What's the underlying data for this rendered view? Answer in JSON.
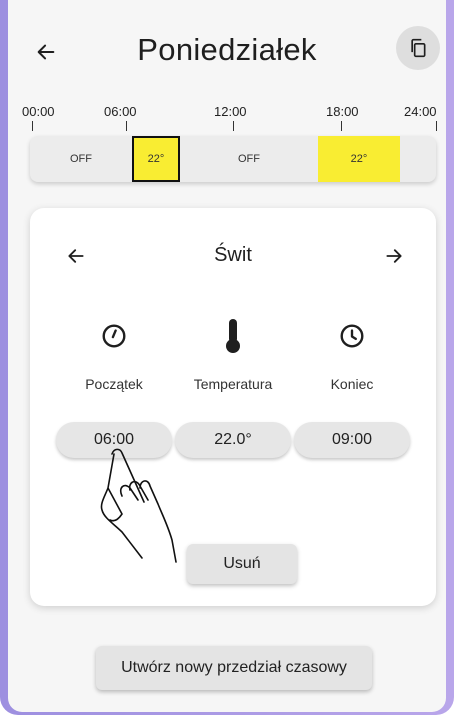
{
  "header": {
    "title": "Poniedziałek"
  },
  "timeline": {
    "ticks": [
      "00:00",
      "06:00",
      "12:00",
      "18:00",
      "24:00"
    ],
    "segments": [
      {
        "label": "OFF",
        "active": false,
        "start": 0,
        "end": 6
      },
      {
        "label": "22°",
        "active": true,
        "selected": true,
        "start": 6,
        "end": 9
      },
      {
        "label": "OFF",
        "active": false,
        "start": 9,
        "end": 17
      },
      {
        "label": "22°",
        "active": true,
        "selected": false,
        "start": 17,
        "end": 21
      },
      {
        "label": "",
        "active": false,
        "start": 21,
        "end": 24
      }
    ]
  },
  "card": {
    "title": "Świt",
    "columns": {
      "start": {
        "label": "Początek",
        "value": "06:00"
      },
      "temperature": {
        "label": "Temperatura",
        "value": "22.0°"
      },
      "end": {
        "label": "Koniec",
        "value": "09:00"
      }
    },
    "delete_label": "Usuń"
  },
  "footer": {
    "new_interval_label": "Utwórz nowy przedział czasowy"
  },
  "colors": {
    "active_segment": "#f9ed32",
    "frame_accent": "#9d8fe0"
  },
  "icons": {
    "back": "arrow-left-icon",
    "copy": "copy-icon",
    "prev": "arrow-left-icon",
    "next": "arrow-right-icon",
    "start": "clock-start-icon",
    "temperature": "thermometer-icon",
    "end": "clock-icon"
  }
}
